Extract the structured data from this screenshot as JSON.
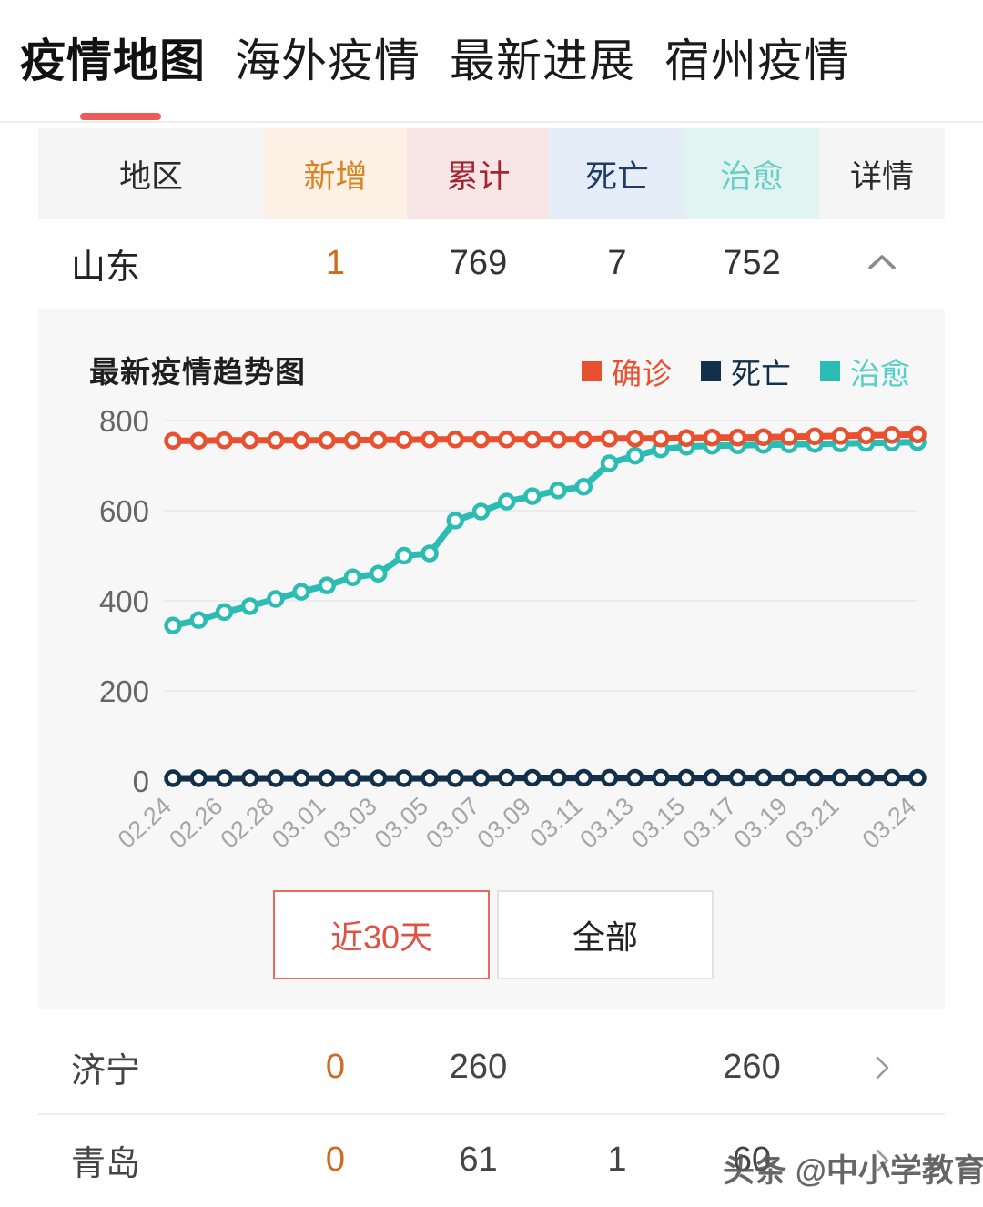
{
  "nav": {
    "tabs": [
      {
        "label": "疫情地图",
        "active": true
      },
      {
        "label": "海外疫情",
        "active": false
      },
      {
        "label": "最新进展",
        "active": false
      },
      {
        "label": "宿州疫情",
        "active": false
      }
    ]
  },
  "table": {
    "headers": {
      "region": "地区",
      "new": "新增",
      "total": "累计",
      "death": "死亡",
      "cured": "治愈",
      "detail": "详情"
    },
    "header_colors": {
      "new_bg": "#fdf0e4",
      "new_fg": "#D98324",
      "total_bg": "#f8e5e6",
      "total_fg": "#A32531",
      "death_bg": "#e5edf9",
      "death_fg": "#1D3D63",
      "cured_bg": "#e2f4f1",
      "cured_fg": "#68CFC8"
    },
    "province_row": {
      "region": "山东",
      "new": "1",
      "total": "769",
      "death": "7",
      "cured": "752",
      "expand_icon": "chevron-up-icon"
    },
    "city_rows": [
      {
        "region": "济宁",
        "new": "0",
        "total": "260",
        "death": "",
        "cured": "260",
        "detail_icon": "chevron-right-icon"
      },
      {
        "region": "青岛",
        "new": "0",
        "total": "61",
        "death": "1",
        "cured": "60",
        "detail_icon": "chevron-right-icon"
      }
    ]
  },
  "chart_panel": {
    "title": "最新疫情趋势图",
    "legend": [
      {
        "label": "确诊",
        "color": "#E8502F"
      },
      {
        "label": "死亡",
        "color": "#12304A"
      },
      {
        "label": "治愈",
        "color": "#2BBCB4"
      }
    ],
    "range_buttons": [
      {
        "label": "近30天",
        "active": true
      },
      {
        "label": "全部",
        "active": false
      }
    ]
  },
  "chart_data": {
    "type": "line",
    "title": "最新疫情趋势图",
    "xlabel": "",
    "ylabel": "",
    "ylim": [
      0,
      800
    ],
    "yticks": [
      0,
      200,
      400,
      600,
      800
    ],
    "grid": true,
    "legend_position": "top-right",
    "x": [
      "02.24",
      "02.25",
      "02.26",
      "02.27",
      "02.28",
      "02.29",
      "03.01",
      "03.02",
      "03.03",
      "03.04",
      "03.05",
      "03.06",
      "03.07",
      "03.08",
      "03.09",
      "03.10",
      "03.11",
      "03.12",
      "03.13",
      "03.14",
      "03.15",
      "03.16",
      "03.17",
      "03.18",
      "03.19",
      "03.20",
      "03.21",
      "03.22",
      "03.23",
      "03.24"
    ],
    "tick_labels": [
      "02.24",
      "",
      "02.26",
      "",
      "02.28",
      "",
      "03.01",
      "",
      "03.03",
      "",
      "03.05",
      "",
      "03.07",
      "",
      "03.09",
      "",
      "03.11",
      "",
      "03.13",
      "",
      "03.15",
      "",
      "03.17",
      "",
      "03.19",
      "",
      "03.21",
      "",
      "",
      "03.24"
    ],
    "series": [
      {
        "name": "确诊",
        "color": "#E8502F",
        "values": [
          755,
          755,
          756,
          756,
          756,
          756,
          756,
          756,
          757,
          757,
          758,
          758,
          758,
          758,
          758,
          758,
          758,
          760,
          760,
          760,
          761,
          762,
          762,
          763,
          764,
          765,
          766,
          767,
          768,
          769
        ]
      },
      {
        "name": "死亡",
        "color": "#12304A",
        "values": [
          6,
          6,
          6,
          6,
          6,
          6,
          6,
          6,
          6,
          6,
          6,
          6,
          6,
          7,
          7,
          7,
          7,
          7,
          7,
          7,
          7,
          7,
          7,
          7,
          7,
          7,
          7,
          7,
          7,
          7
        ]
      },
      {
        "name": "治愈",
        "color": "#2BBCB4",
        "values": [
          345,
          357,
          375,
          388,
          404,
          420,
          434,
          452,
          460,
          500,
          505,
          578,
          598,
          620,
          632,
          645,
          653,
          705,
          722,
          736,
          742,
          744,
          745,
          746,
          747,
          748,
          749,
          750,
          751,
          752
        ]
      }
    ]
  },
  "watermark": {
    "text": "头条 @中小学教育者"
  }
}
